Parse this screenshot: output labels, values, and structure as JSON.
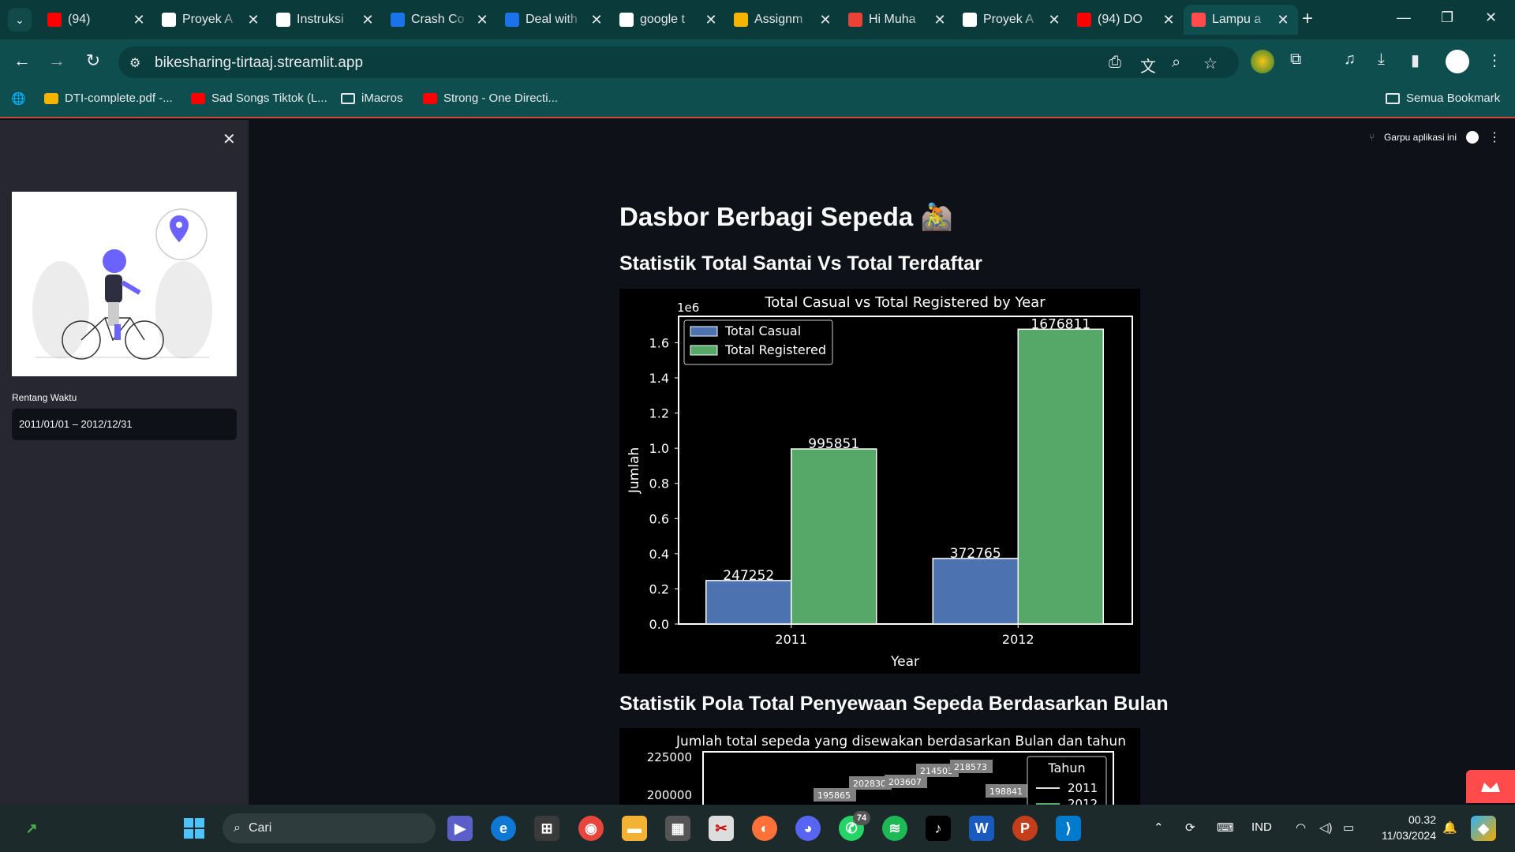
{
  "browser": {
    "tabs": [
      {
        "title": "(94)",
        "icon": "youtube-icon",
        "color": "#ff0000"
      },
      {
        "title": "Proyek A",
        "icon": "dicoding-icon",
        "color": "#ffffff"
      },
      {
        "title": "Instruksi",
        "icon": "dicoding-icon",
        "color": "#ffffff"
      },
      {
        "title": "Crash Co",
        "icon": "c-icon",
        "color": "#1a73e8"
      },
      {
        "title": "Deal with",
        "icon": "c-icon",
        "color": "#1a73e8"
      },
      {
        "title": "google t",
        "icon": "google-icon",
        "color": "#ffffff"
      },
      {
        "title": "Assignm",
        "icon": "classroom-icon",
        "color": "#f4b400"
      },
      {
        "title": "Hi Muha",
        "icon": "gmail-icon",
        "color": "#ea4335"
      },
      {
        "title": "Proyek A",
        "icon": "dicoding-icon",
        "color": "#ffffff"
      },
      {
        "title": "(94) DO",
        "icon": "youtube-icon",
        "color": "#ff0000"
      },
      {
        "title": "Lampu a",
        "icon": "streamlit-icon",
        "color": "#ff4b4b",
        "active": true
      }
    ],
    "url": "bikesharing-tirtaaj.streamlit.app",
    "bookmarks": [
      {
        "label": "DTI-complete.pdf -...",
        "icon": "drive-icon"
      },
      {
        "label": "Sad Songs Tiktok (L...",
        "icon": "youtube-icon"
      },
      {
        "label": "iMacros",
        "icon": "folder-icon"
      },
      {
        "label": "Strong - One Directi...",
        "icon": "youtube-icon"
      }
    ],
    "all_bookmarks": "Semua Bookmark"
  },
  "sidebar": {
    "date_label": "Rentang Waktu",
    "date_value": "2011/01/01 – 2012/12/31"
  },
  "header": {
    "fork_label": "Garpu aplikasi ini"
  },
  "main": {
    "title": "Dasbor Berbagi Sepeda 🚵",
    "section1": "Statistik Total Santai Vs Total Terdaftar",
    "section2": "Statistik Pola Total Penyewaan Sepeda Berdasarkan Bulan"
  },
  "chart_data": [
    {
      "type": "bar",
      "title": "Total Casual vs Total Registered by Year",
      "xlabel": "Year",
      "ylabel": "Jumlah",
      "scale_label": "1e6",
      "categories": [
        "2011",
        "2012"
      ],
      "series": [
        {
          "name": "Total Casual",
          "values": [
            247252,
            372765
          ],
          "color": "#4c72b0"
        },
        {
          "name": "Total Registered",
          "values": [
            995851,
            1676811
          ],
          "color": "#55a868"
        }
      ],
      "ylim": [
        0,
        1.75
      ],
      "yticks": [
        "0.0",
        "0.2",
        "0.4",
        "0.6",
        "0.8",
        "1.0",
        "1.2",
        "1.4",
        "1.6"
      ],
      "legend": "top-left"
    },
    {
      "type": "line",
      "title": "Jumlah total sepeda yang disewakan berdasarkan Bulan dan tahun",
      "yticks": [
        "225000",
        "200000"
      ],
      "legend_title": "Tahun",
      "legend": [
        "2011",
        "2012"
      ],
      "visible_labels": [
        "195865",
        "202830",
        "203607",
        "214503",
        "218573",
        "198841"
      ]
    }
  ],
  "taskbar": {
    "search_placeholder": "Cari",
    "whatsapp_badge": "74",
    "language": "IND",
    "time": "00.32",
    "date": "11/03/2024"
  }
}
